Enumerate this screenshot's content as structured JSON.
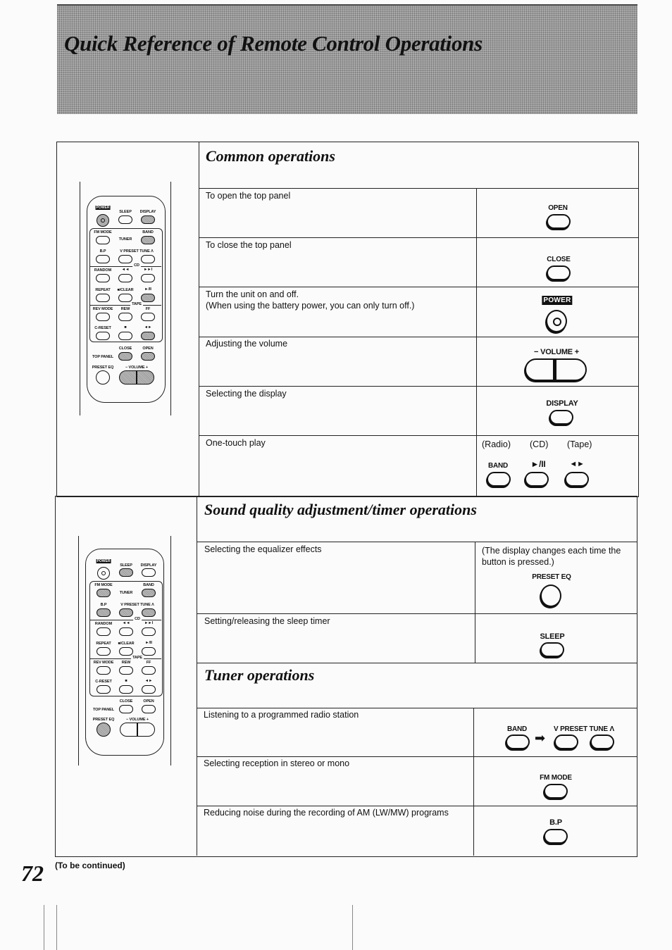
{
  "page": {
    "title": "Quick Reference of Remote Control Operations",
    "page_number": "72",
    "footer_note": "(To be continued)"
  },
  "sections": {
    "common": {
      "title": "Common operations",
      "rows": [
        {
          "operation": "To open the top panel",
          "button_label": "OPEN"
        },
        {
          "operation": "To close the top panel",
          "button_label": "CLOSE"
        },
        {
          "operation": "Turn the unit on and off.",
          "operation_note": "(When using the battery power, you can only turn off.)",
          "button_label": "POWER"
        },
        {
          "operation": "Adjusting the volume",
          "button_label": "− VOLUME +"
        },
        {
          "operation": "Selecting the display",
          "button_label": "DISPLAY"
        },
        {
          "operation": "One-touch play",
          "sources": [
            "(Radio)",
            "(CD)",
            "(Tape)"
          ],
          "buttons": [
            "BAND",
            "►/II",
            "◄►"
          ]
        }
      ]
    },
    "sound": {
      "title": "Sound quality adjustment/timer operations",
      "rows": [
        {
          "operation": "Selecting the equalizer effects",
          "note": "(The display changes each time the button is pressed.)",
          "button_label": "PRESET EQ"
        },
        {
          "operation": "Setting/releasing the sleep timer",
          "button_label": "SLEEP"
        }
      ]
    },
    "tuner": {
      "title": "Tuner operations",
      "rows": [
        {
          "operation": "Listening to a programmed radio station",
          "buttons": [
            "BAND",
            "V PRESET TUNE Λ"
          ]
        },
        {
          "operation": "Selecting reception in stereo or mono",
          "button_label": "FM MODE"
        },
        {
          "operation": "Reducing noise during the recording of AM (LW/MW) programs",
          "button_label": "B.P"
        }
      ]
    }
  },
  "remote": {
    "labels": {
      "power": "POWER",
      "sleep": "SLEEP",
      "display": "DISPLAY",
      "fm_mode": "FM MODE",
      "tuner": "TUNER",
      "band": "BAND",
      "bp": "B.P",
      "preset_tune": "V PRESET TUNE Λ",
      "cd": "CD",
      "random": "RANDOM",
      "prev": "◄◄",
      "next": "►►I",
      "repeat": "REPEAT",
      "stop_clear": "■/CLEAR",
      "play_pause": "►/II",
      "tape": "TAPE",
      "rev_mode": "REV MODE",
      "rew": "REW",
      "ff": "FF",
      "c_reset": "C-RESET",
      "stop": "■",
      "tape_play": "◄►",
      "close": "CLOSE",
      "open": "OPEN",
      "top_panel": "TOP PANEL",
      "preset_eq": "PRESET EQ",
      "volume": "− VOLUME +"
    }
  }
}
